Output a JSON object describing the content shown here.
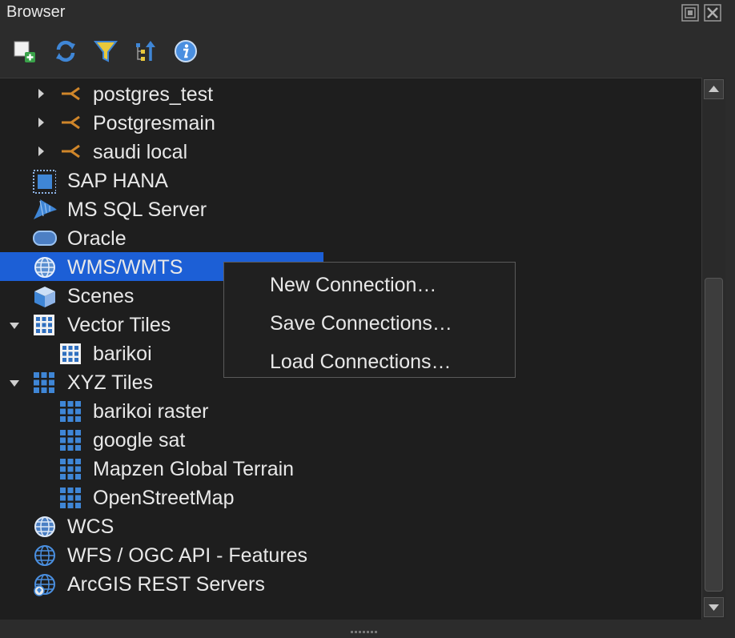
{
  "window": {
    "title": "Browser"
  },
  "toolbar": {
    "buttons": [
      {
        "name": "add-selected-layers",
        "icon": "add-layer-icon"
      },
      {
        "name": "refresh",
        "icon": "refresh-icon"
      },
      {
        "name": "filter",
        "icon": "filter-icon"
      },
      {
        "name": "collapse-all",
        "icon": "collapse-icon"
      },
      {
        "name": "properties",
        "icon": "info-icon"
      }
    ]
  },
  "tree": {
    "items": [
      {
        "label": "postgres_test",
        "icon": "postgres-connection-icon"
      },
      {
        "label": "Postgresmain",
        "icon": "postgres-connection-icon"
      },
      {
        "label": "saudi local",
        "icon": "postgres-connection-icon"
      },
      {
        "label": "SAP HANA",
        "icon": "sap-hana-icon"
      },
      {
        "label": "MS SQL Server",
        "icon": "mssql-icon"
      },
      {
        "label": "Oracle",
        "icon": "oracle-icon"
      },
      {
        "label": "WMS/WMTS",
        "icon": "globe-icon",
        "selected": true
      },
      {
        "label": "Scenes",
        "icon": "scenes-icon"
      },
      {
        "label": "Vector Tiles",
        "icon": "grid-icon"
      },
      {
        "label": "barikoi",
        "icon": "grid-icon"
      },
      {
        "label": "XYZ Tiles",
        "icon": "tiles-icon"
      },
      {
        "label": "barikoi raster",
        "icon": "tiles-icon"
      },
      {
        "label": "google sat",
        "icon": "tiles-icon"
      },
      {
        "label": "Mapzen Global Terrain",
        "icon": "tiles-icon"
      },
      {
        "label": "OpenStreetMap",
        "icon": "tiles-icon"
      },
      {
        "label": "WCS",
        "icon": "globe-icon"
      },
      {
        "label": "WFS / OGC API - Features",
        "icon": "globe-icon"
      },
      {
        "label": "ArcGIS REST Servers",
        "icon": "arcgis-globe-icon"
      }
    ]
  },
  "context_menu": {
    "items": [
      {
        "label": "New Connection…"
      },
      {
        "label": "Save Connections…"
      },
      {
        "label": "Load Connections…"
      }
    ]
  },
  "colors": {
    "selection": "#1c5fd6",
    "postgres": "#d0862a",
    "icon_blue": "#3f86d6",
    "background": "#1e1e1e"
  }
}
